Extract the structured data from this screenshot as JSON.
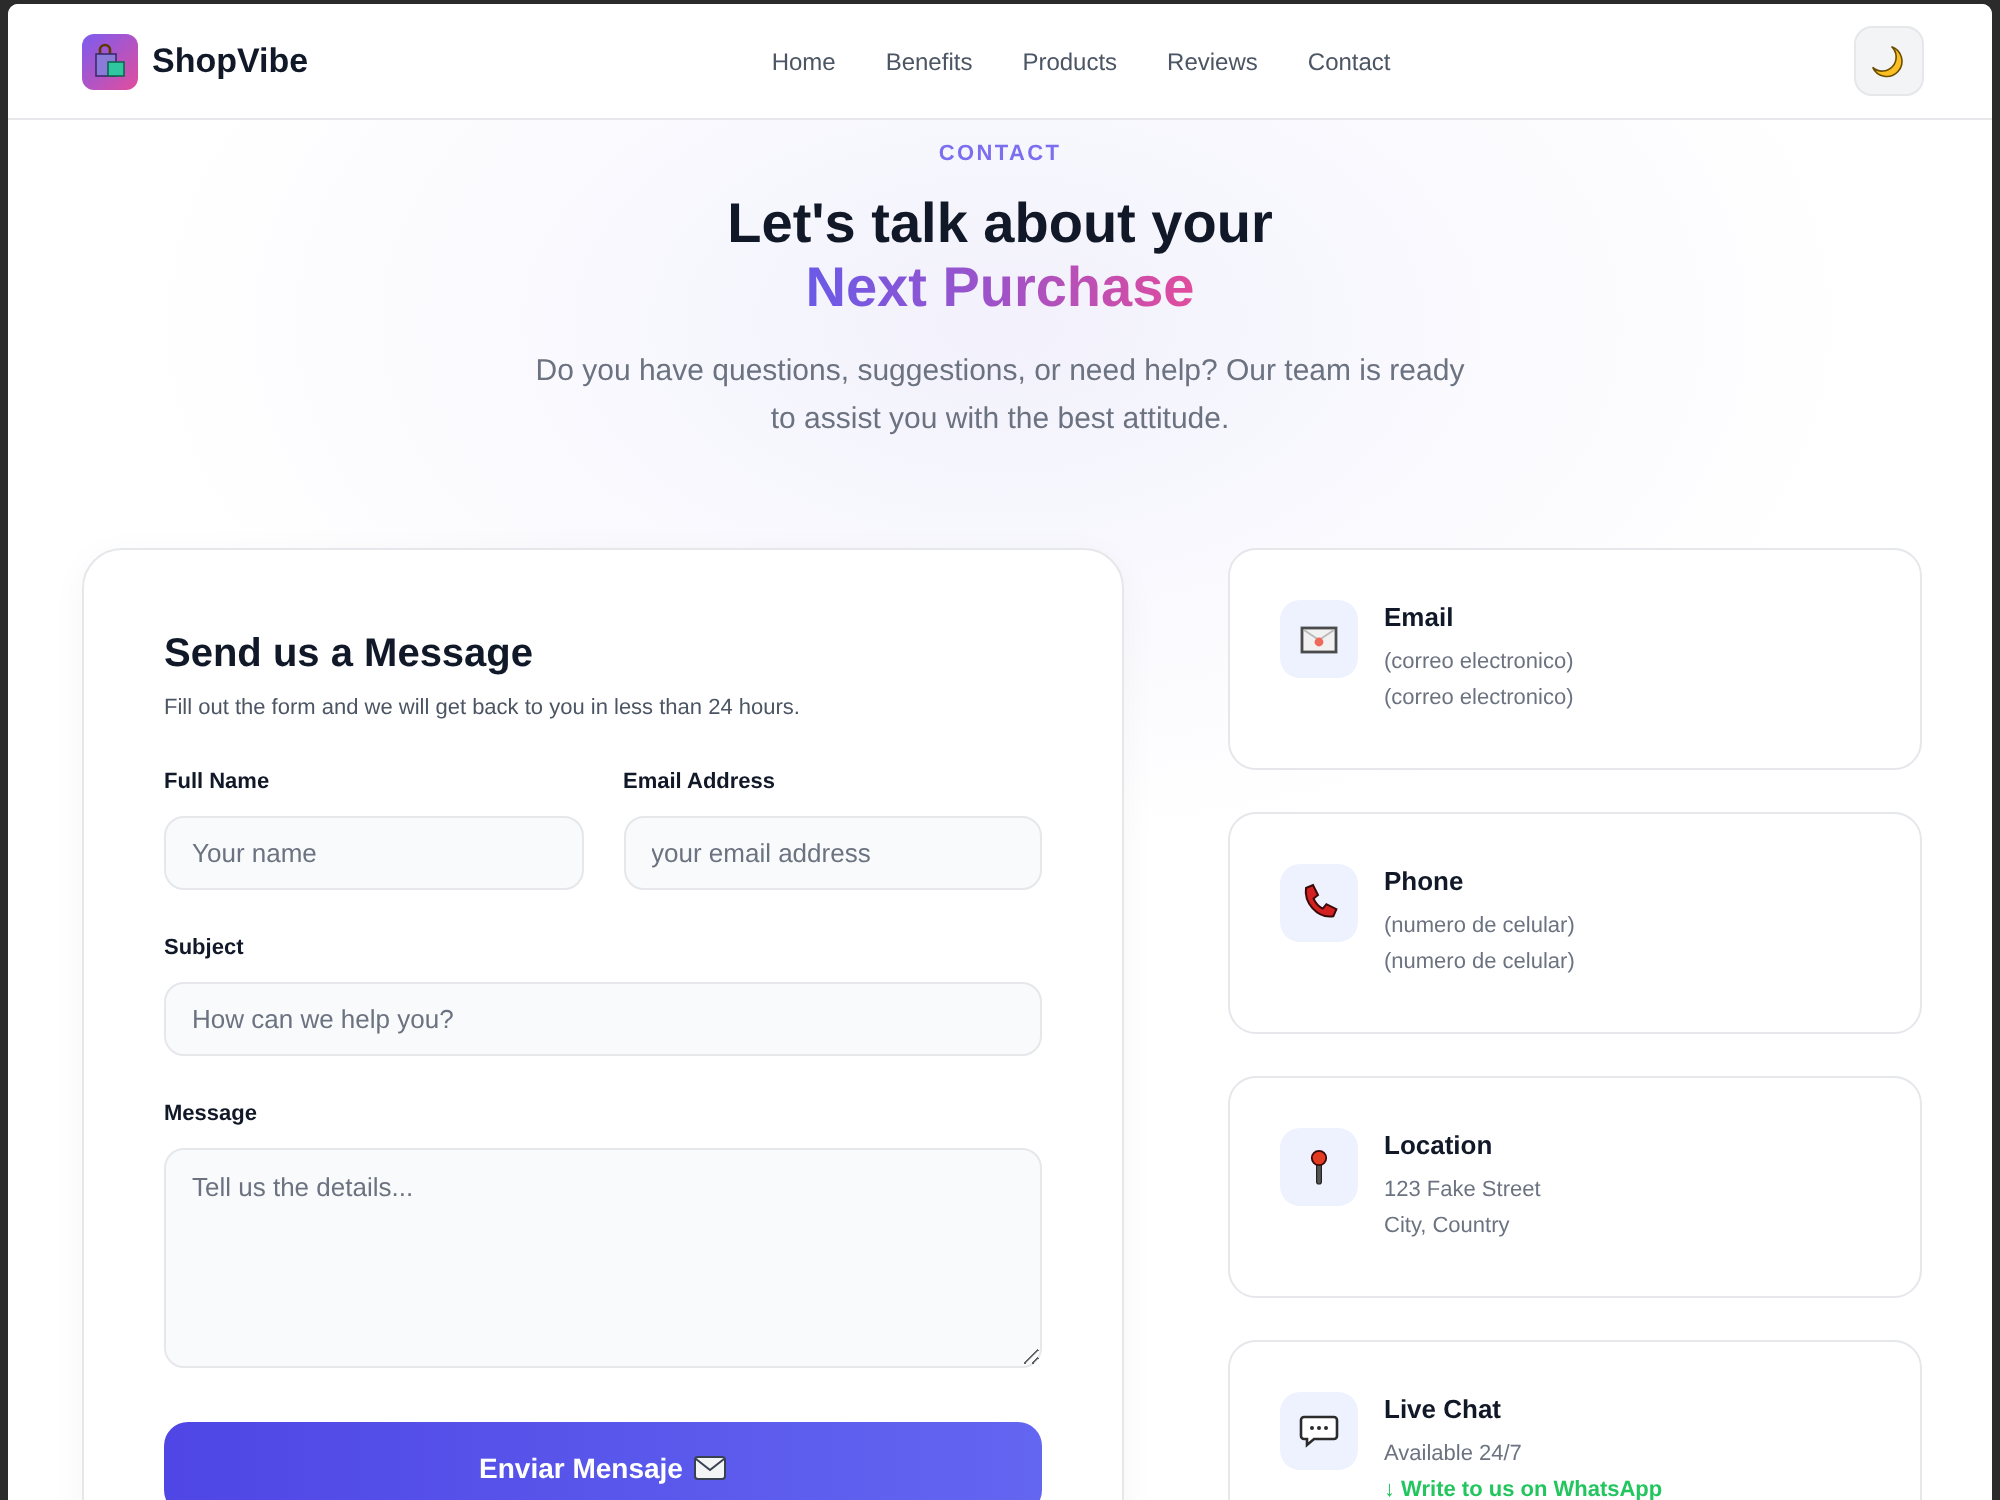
{
  "brand": {
    "name": "ShopVibe"
  },
  "nav": {
    "links": [
      "Home",
      "Benefits",
      "Products",
      "Reviews",
      "Contact"
    ]
  },
  "hero": {
    "eyebrow": "CONTACT",
    "title": "Let's talk about your",
    "highlight": "Next Purchase",
    "description": "Do you have questions, suggestions, or need help? Our team is ready to assist you with the best attitude."
  },
  "form": {
    "title": "Send us a Message",
    "subtitle": "Fill out the form and we will get back to you in less than 24 hours.",
    "rows": [
      {
        "fields": [
          {
            "kind": "input",
            "label": "Full Name",
            "placeholder": "Your name"
          },
          {
            "kind": "input",
            "label": "Email Address",
            "placeholder": "your email address"
          }
        ]
      },
      {
        "fields": [
          {
            "kind": "input",
            "label": "Subject",
            "placeholder": "How can we help you?"
          }
        ]
      },
      {
        "fields": [
          {
            "kind": "textarea",
            "label": "Message",
            "placeholder": "Tell us the details..."
          }
        ]
      }
    ],
    "submit": {
      "label": "Enviar Mensaje"
    }
  },
  "contact_cards": [
    {
      "kind": "email",
      "title": "Email",
      "lines": [
        "(correo electronico)",
        "(correo electronico)"
      ]
    },
    {
      "kind": "phone",
      "title": "Phone",
      "lines": [
        "(numero de celular)",
        "(numero de celular)"
      ]
    },
    {
      "kind": "location",
      "title": "Location",
      "lines": [
        "123 Fake Street",
        "City, Country"
      ]
    },
    {
      "kind": "chat",
      "title": "Live Chat",
      "lines": [
        "Available 24/7"
      ],
      "link": "↓ Write to us on WhatsApp"
    }
  ]
}
